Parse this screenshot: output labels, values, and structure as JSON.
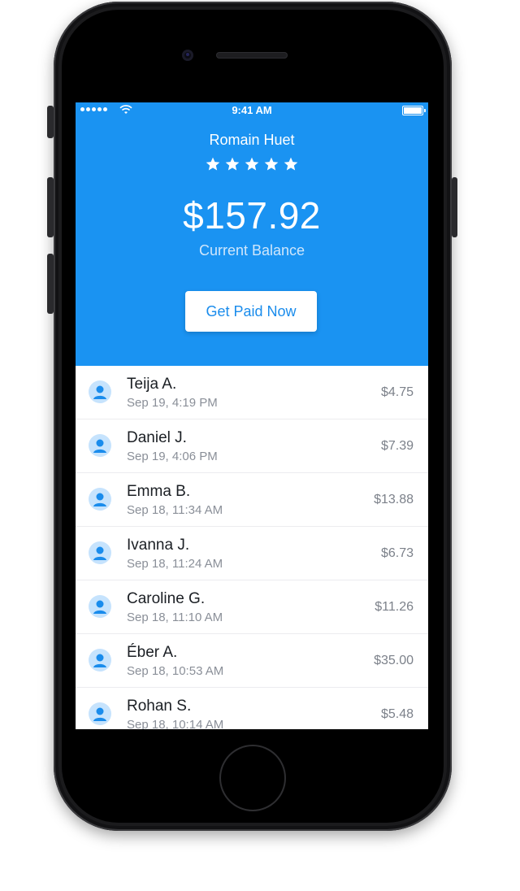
{
  "status_bar": {
    "time": "9:41 AM"
  },
  "profile": {
    "name": "Romain Huet",
    "rating": 5,
    "balance": "$157.92",
    "balance_label": "Current Balance",
    "action_label": "Get Paid Now"
  },
  "colors": {
    "accent": "#1a93f2",
    "avatar_bg": "#c6e3fd",
    "avatar_fg": "#1a8cec"
  },
  "transactions": [
    {
      "name": "Teija A.",
      "date": "Sep 19, 4:19 PM",
      "amount": "$4.75"
    },
    {
      "name": "Daniel J.",
      "date": "Sep 19, 4:06 PM",
      "amount": "$7.39"
    },
    {
      "name": "Emma B.",
      "date": "Sep 18, 11:34 AM",
      "amount": "$13.88"
    },
    {
      "name": "Ivanna J.",
      "date": "Sep 18, 11:24 AM",
      "amount": "$6.73"
    },
    {
      "name": "Caroline G.",
      "date": "Sep 18, 11:10 AM",
      "amount": "$11.26"
    },
    {
      "name": "Éber A.",
      "date": "Sep 18, 10:53 AM",
      "amount": "$35.00"
    },
    {
      "name": "Rohan S.",
      "date": "Sep 18, 10:14 AM",
      "amount": "$5.48"
    }
  ]
}
